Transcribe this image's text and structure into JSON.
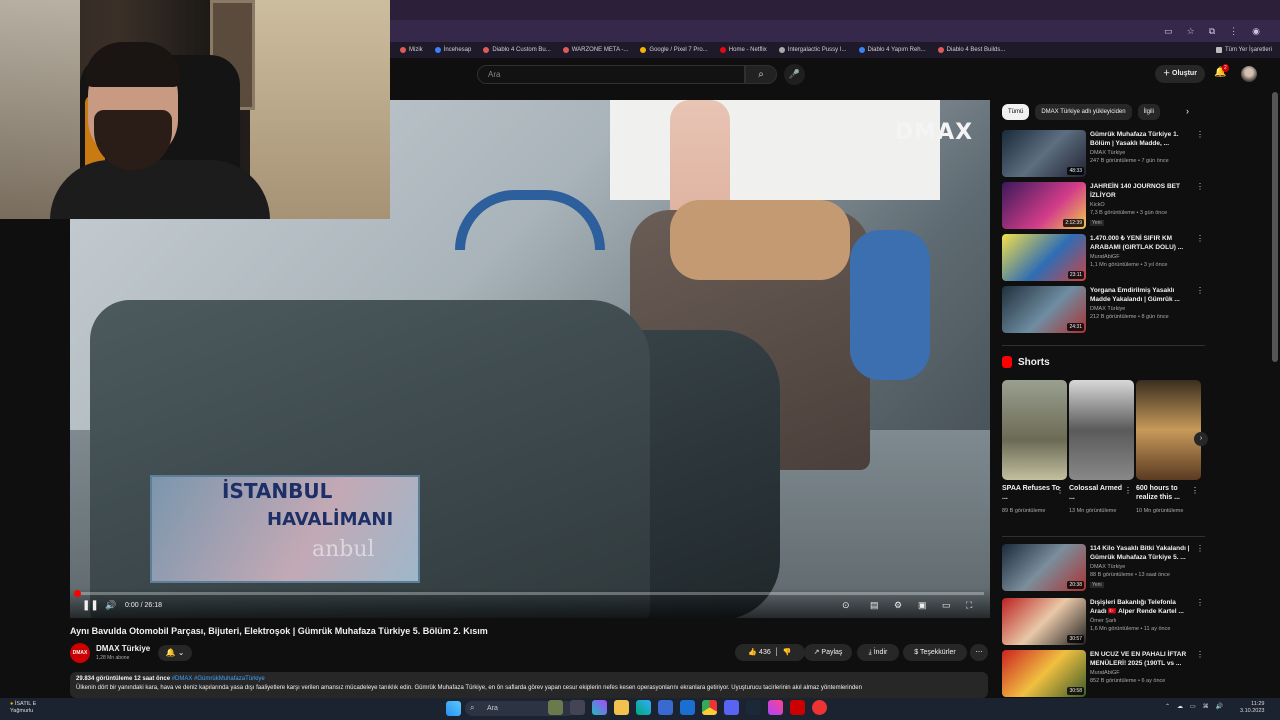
{
  "browser": {
    "bookmarks": [
      "Mizik",
      "İncehesap",
      "Diablo 4 Custom Bu...",
      "WARZONE META -...",
      "Google / Pixel 7 Pro...",
      "Home - Netflix",
      "Intergalactic Pussy I...",
      "Diablo 4 Yapım Reh...",
      "Diablo 4 Best Builds..."
    ],
    "other_bookmarks": "Tüm Yer İşaretleri"
  },
  "header": {
    "search_placeholder": "Ara",
    "create_label": "Oluştur",
    "notifications_count": "2"
  },
  "player": {
    "channel_watermark": "DMAX",
    "overlay_line1": "İSTANBUL",
    "overlay_line2": "HAVALİMANI",
    "overlay_ghost": "anbul",
    "time": "0:00 / 26:18",
    "progress": 0.0
  },
  "video": {
    "title": "Aynı Bavulda Otomobil Parçası, Bijuteri, Elektroşok | Gümrük Muhafaza Türkiye 5. Bölüm 2. Kısım",
    "channel_name": "DMAX Türkiye",
    "channel_avatar_text": "DMAX",
    "subscribers": "1,28 Mn abone",
    "likes": "436",
    "share_label": "Paylaş",
    "download_label": "İndir",
    "thanks_label": "Teşekkürler",
    "views_date": "29.834 görüntüleme  12 saat önce",
    "tags": "#DMAX #GümrükMuhafazaTürkiye",
    "description": "Ülkenin dört bir yanındaki kara, hava ve deniz kapılarında yasa dışı faaliyetlere karşı verilen amansız mücadeleye tanıklık edin. Gümrük Muhafaza Türkiye, en ön saflarda görev yapan cesur ekiplerin nefes kesen operasyonlarını ekranlara getiriyor. Uyuşturucu tacirlerinin akıl almaz yöntemlerinden"
  },
  "sidebar": {
    "chips": [
      "Tümü",
      "DMAX Türkiye adlı yükleyiciden",
      "İlgili"
    ],
    "recommendations": [
      {
        "title": "Gümrük Muhafaza Türkiye 1. Bölüm | Yasaklı Madde, ...",
        "channel": "DMAX Türkiye",
        "meta": "247 B görüntüleme • 7 gün önce",
        "duration": "48:33",
        "new": ""
      },
      {
        "title": "JAHREİN 140 JOURNOS BET İZLİYOR",
        "channel": "KickO",
        "meta": "7,3 B görüntüleme • 3 gün önce",
        "duration": "2:12:39",
        "new": "Yeni"
      },
      {
        "title": "1.470.000 ₺ YENİ SIFIR KM ARABAMI (GIRTLAK DOLU) ...",
        "channel": "MuratAbiGF",
        "meta": "1,1 Mn görüntüleme • 3 yıl önce",
        "duration": "23:11",
        "new": ""
      },
      {
        "title": "Yorgana Emdirilmiş Yasaklı Madde Yakalandı | Gümrük ...",
        "channel": "DMAX Türkiye",
        "meta": "212 B görüntüleme • 8 gün önce",
        "duration": "24:31",
        "new": ""
      }
    ],
    "shorts_heading": "Shorts",
    "shorts": [
      {
        "title": "SPAA Refuses To ...",
        "meta": "89 B görüntüleme"
      },
      {
        "title": "Colossal Armed ...",
        "meta": "13 Mn görüntüleme"
      },
      {
        "title": "600 hours to realize this ...",
        "meta": "10 Mn görüntüleme"
      }
    ],
    "more_recommendations": [
      {
        "title": "114 Kilo Yasaklı Bitki Yakalandı | Gümrük Muhafaza Türkiye 5. ...",
        "channel": "DMAX Türkiye",
        "meta": "88 B görüntüleme • 13 saat önce",
        "duration": "20:38",
        "new": "Yeni"
      },
      {
        "title": "Dışişleri Bakanlığı Telefonla Aradı 🇹🇷 Alper Rende Kartel ...",
        "channel": "Ömer Şarlı",
        "meta": "1,6 Mn görüntüleme • 11 ay önce",
        "duration": "30:57",
        "new": ""
      },
      {
        "title": "EN UCUZ VE EN PAHALI İFTAR MENÜLERİ! 2025 (190TL vs ...",
        "channel": "MuratAbiGF",
        "meta": "852 B görüntüleme • 6 ay önce",
        "duration": "30:58",
        "new": ""
      }
    ]
  },
  "taskbar": {
    "weather_label": "İSATIL E",
    "weather_sub": "Yağmurlu",
    "search_label": "Ara",
    "time": "11:29",
    "date": "3.10.2023"
  }
}
